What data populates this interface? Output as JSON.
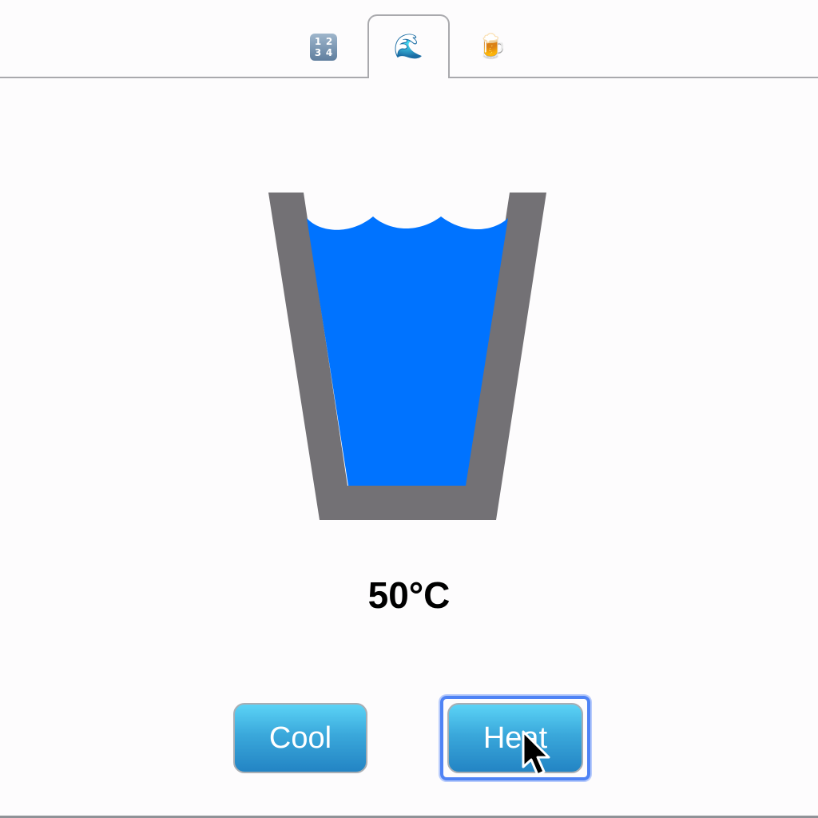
{
  "tabs": [
    {
      "icon": "numbers-icon",
      "digits": [
        "1",
        "2",
        "3",
        "4"
      ],
      "active": false
    },
    {
      "icon": "wave-icon",
      "glyph": "🌊",
      "active": true
    },
    {
      "icon": "beer-mug-icon",
      "glyph": "🍺",
      "active": false
    }
  ],
  "glass": {
    "fill_level": 0.87,
    "water_color": "#0073ff",
    "glass_color": "#737175"
  },
  "temperature": {
    "label": "50°C"
  },
  "buttons": {
    "cool_label": "Cool",
    "heat_label": "Heat",
    "focused": "heat"
  },
  "colors": {
    "button_top": "#5bd3f6",
    "button_bottom": "#2384c4",
    "focus_ring": "#4f83f5"
  }
}
